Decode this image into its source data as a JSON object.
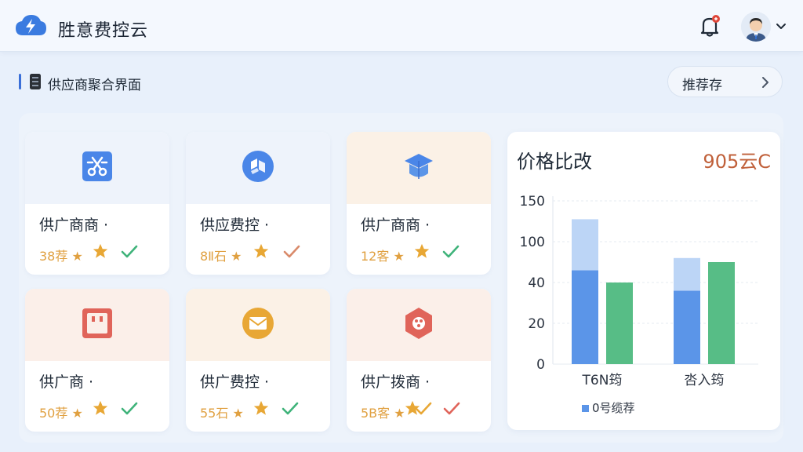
{
  "app": {
    "title": "胜意费控云",
    "logo_icon": "cloud-bolt-icon",
    "accent": "#3a7be0",
    "notification_icon": "bell-icon",
    "notification_dot_color": "#e0473a",
    "user_icon": "user-avatar",
    "menu_icon": "chevron-down-icon"
  },
  "page": {
    "icon": "document-icon",
    "title": "供应商聚合界面",
    "recommend_button": "推荐存",
    "recommend_icon": "chevron-right-icon"
  },
  "cards": [
    {
      "name": "供广商商 ·",
      "metric": "38荐 ★",
      "icon": "scissors-tool-icon",
      "icon_color": "#4a86e8",
      "header_color": "#eef3fb",
      "status_icon": "check-icon",
      "status_color": "#3fb37a"
    },
    {
      "name": "供应费控 ·",
      "metric": "8Ⅱ石 ★",
      "icon": "cube-icon",
      "icon_color": "#4a86e8",
      "header_color": "#eef3fb",
      "status_icon": "check-icon",
      "status_color": "#d98a6a"
    },
    {
      "name": "供广商商 ·",
      "metric": "12客 ★",
      "icon": "graduation-cap-icon",
      "icon_color": "#4a86e8",
      "header_color": "#fbf1e6",
      "status_icon": "check-icon",
      "status_color": "#3fb37a"
    },
    {
      "name": "供广商 ·",
      "metric": "50荐 ★",
      "icon": "calendar-square-icon",
      "icon_color": "#e0645a",
      "header_color": "#fbefe9",
      "status_icon": "check-icon",
      "status_color": "#3fb37a"
    },
    {
      "name": "供广费控 ·",
      "metric": "55石 ★",
      "icon": "envelope-icon",
      "icon_color": "#e8a735",
      "header_color": "#fbf1e6",
      "status_icon": "check-icon",
      "status_color": "#3fb37a"
    },
    {
      "name": "供广拨商 ·",
      "metric": "5B客 ★",
      "icon": "hexagon-nodes-icon",
      "icon_color": "#e0645a",
      "header_color": "#fbefe9",
      "status_icon": "check-icon",
      "status_color": "#e8a735",
      "status2_icon": "check-icon",
      "status2_color": "#e0645a"
    }
  ],
  "chart": {
    "title": "价格比改",
    "value": "905云C"
  },
  "chart_data": {
    "type": "bar",
    "categories": [
      "T6N筠",
      "呇入筠"
    ],
    "y_tick_labels": [
      "0",
      "20",
      "40",
      "100",
      "150"
    ],
    "series": [
      {
        "name": "0号缆荐",
        "values": [
          46,
          36
        ],
        "color": "#5b95e8"
      },
      {
        "values": [
          25,
          16
        ],
        "color": "#bcd5f6",
        "stacked_on": "0号缆荐"
      },
      {
        "values": [
          40,
          50
        ],
        "color": "#57bd86"
      }
    ],
    "stacked": true,
    "grid": true,
    "legend": "bottom-left"
  }
}
